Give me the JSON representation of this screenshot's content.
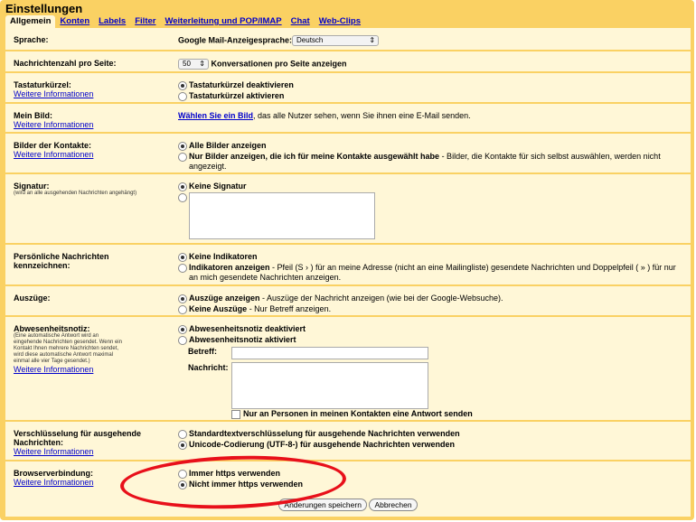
{
  "title": "Einstellungen",
  "tabs": [
    "Allgemein",
    "Konten",
    "Labels",
    "Filter",
    "Weiterleitung und POP/IMAP",
    "Chat",
    "Web-Clips"
  ],
  "more": "Weitere Informationen",
  "sprache": {
    "label": "Sprache:",
    "text": "Google Mail-Anzeigesprache:",
    "value": "Deutsch"
  },
  "nachrichten": {
    "label": "Nachrichtenzahl pro Seite:",
    "value": "50",
    "text": "Konversationen pro Seite anzeigen"
  },
  "tastatur": {
    "label": "Tastaturkürzel:",
    "opt1": "Tastaturkürzel deaktivieren",
    "opt2": "Tastaturkürzel aktivieren"
  },
  "bild": {
    "label": "Mein Bild:",
    "link": "Wählen Sie ein Bild",
    "text": ", das alle Nutzer sehen, wenn Sie ihnen eine E-Mail senden."
  },
  "kontakte": {
    "label": "Bilder der Kontakte:",
    "opt1": "Alle Bilder anzeigen",
    "opt2": "Nur Bilder anzeigen, die ich für meine Kontakte ausgewählt habe",
    "opt2_desc": " - Bilder, die Kontakte für sich selbst auswählen, werden nicht angezeigt."
  },
  "signatur": {
    "label": "Signatur:",
    "sub": "(wird an alle ausgehenden Nachrichten angehängt)",
    "opt1": "Keine Signatur"
  },
  "persoenlich": {
    "label": "Persönliche Nachrichten kennzeichnen:",
    "opt1": "Keine Indikatoren",
    "opt2": "Indikatoren anzeigen",
    "opt2_desc": " - Pfeil (S › ) für an meine Adresse (nicht an eine Mailingliste) gesendete Nachrichten und Doppelpfeil ( » ) für nur an mich gesendete Nachrichten anzeigen."
  },
  "auszuege": {
    "label": "Auszüge:",
    "opt1": "Auszüge anzeigen",
    "opt1_desc": " - Auszüge der Nachricht anzeigen (wie bei der Google-Websuche).",
    "opt2": "Keine Auszüge",
    "opt2_desc": " - Nur Betreff anzeigen."
  },
  "abwesenheit": {
    "label": "Abwesenheitsnotiz:",
    "sub": "(Eine automatische Antwort wird an eingehende Nachrichten gesendet. Wenn ein Kontakt Ihnen mehrere Nachrichten sendet, wird diese automatische Antwort maximal einmal alle vier Tage gesendet.)",
    "opt1": "Abwesenheitsnotiz deaktiviert",
    "opt2": "Abwesenheitsnotiz aktiviert",
    "betreff": "Betreff:",
    "nachricht": "Nachricht:",
    "checkbox": "Nur an Personen in meinen Kontakten eine Antwort senden"
  },
  "verschluesselung": {
    "label": "Verschlüsselung für ausgehende Nachrichten:",
    "opt1": "Standardtextverschlüsselung für ausgehende Nachrichten verwenden",
    "opt2": "Unicode-Codierung (UTF-8-) für ausgehende Nachrichten verwenden"
  },
  "browser": {
    "label": "Browserverbindung:",
    "opt1": "Immer https verwenden",
    "opt2": "Nicht immer https verwenden"
  },
  "buttons": {
    "save": "Änderungen speichern",
    "cancel": "Abbrechen"
  },
  "annotation_color": "#e8101a"
}
